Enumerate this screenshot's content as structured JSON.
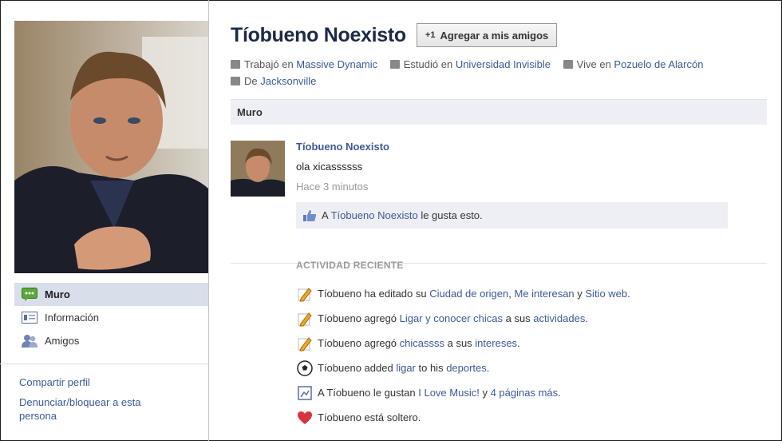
{
  "profile": {
    "name": "Tíobueno Noexisto",
    "add_friend_label": "Agregar a mis amigos",
    "info": [
      {
        "prefix": "Trabajó en ",
        "link": "Massive Dynamic",
        "icon": "briefcase-icon"
      },
      {
        "prefix": "Estudió en ",
        "link": "Universidad Invisible",
        "icon": "graduation-cap-icon"
      },
      {
        "prefix": "Vive en ",
        "link": "Pozuelo de Alarcón",
        "icon": "building-icon"
      },
      {
        "prefix": "De ",
        "link": "Jacksonville",
        "icon": "home-icon"
      }
    ]
  },
  "sidebar": {
    "nav": [
      {
        "label": "Muro",
        "icon": "wall-icon",
        "active": true
      },
      {
        "label": "Información",
        "icon": "info-card-icon",
        "active": false
      },
      {
        "label": "Amigos",
        "icon": "friends-icon",
        "active": false
      }
    ],
    "links": [
      "Compartir perfil",
      "Denunciar/bloquear a esta persona"
    ]
  },
  "wall": {
    "title": "Muro",
    "post": {
      "author": "Tíobueno Noexisto",
      "text": "ola xicassssss",
      "time": "Hace 3 minutos",
      "like": {
        "pre": "A ",
        "link": "Tíobueno Noexisto",
        "post": " le gusta esto."
      }
    }
  },
  "activity": {
    "title": "ACTIVIDAD RECIENTE",
    "items": [
      {
        "icon": "pencil-icon",
        "parts": [
          [
            "Tíobueno ha editado su ",
            false
          ],
          [
            "Ciudad de origen",
            true
          ],
          [
            ", ",
            false
          ],
          [
            "Me interesan",
            true
          ],
          [
            " y ",
            false
          ],
          [
            "Sitio web",
            true
          ],
          [
            ".",
            false
          ]
        ]
      },
      {
        "icon": "pencil-icon",
        "parts": [
          [
            "Tíobueno agregó ",
            false
          ],
          [
            "Ligar y conocer chicas",
            true
          ],
          [
            " a sus ",
            false
          ],
          [
            "actividades",
            true
          ],
          [
            ".",
            false
          ]
        ]
      },
      {
        "icon": "pencil-icon",
        "parts": [
          [
            "Tíobueno agregó ",
            false
          ],
          [
            "chicassss",
            true
          ],
          [
            " a sus ",
            false
          ],
          [
            "intereses",
            true
          ],
          [
            ".",
            false
          ]
        ]
      },
      {
        "icon": "soccer-ball-icon",
        "parts": [
          [
            "Tíobueno added ",
            false
          ],
          [
            "ligar",
            true
          ],
          [
            " to his ",
            false
          ],
          [
            "deportes",
            true
          ],
          [
            ".",
            false
          ]
        ]
      },
      {
        "icon": "page-icon",
        "parts": [
          [
            "A Tíobueno le gustan ",
            false
          ],
          [
            "I Love Music!",
            true
          ],
          [
            " y ",
            false
          ],
          [
            "4 páginas más",
            true
          ],
          [
            ".",
            false
          ]
        ]
      },
      {
        "icon": "heart-icon",
        "parts": [
          [
            "Tíobueno está soltero.",
            false
          ]
        ]
      }
    ]
  },
  "colors": {
    "link": "#3b5998",
    "nav_active": "#d8dfea",
    "bar": "#edeff4"
  }
}
